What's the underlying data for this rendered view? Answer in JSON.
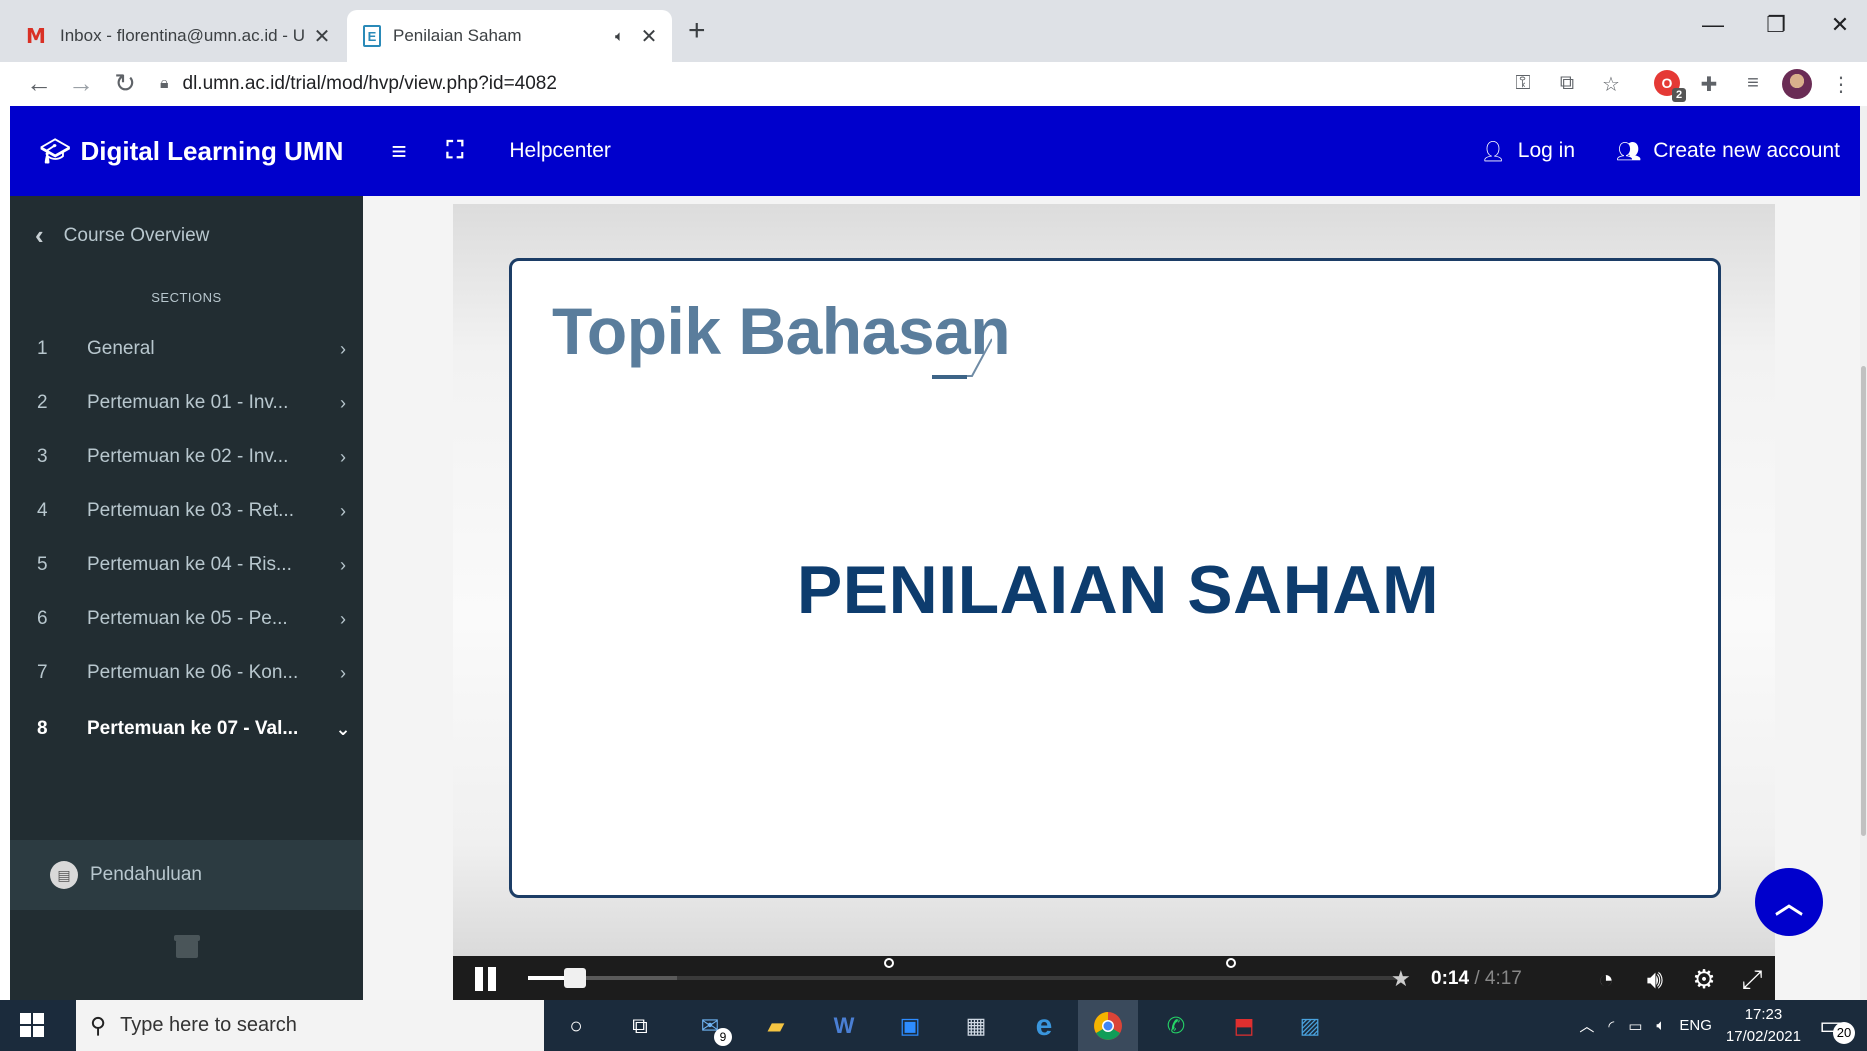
{
  "browser": {
    "tabs": [
      {
        "title": "Inbox - florentina@umn.ac.id - U",
        "favicon": "gmail-icon"
      },
      {
        "title": "Penilaian Saham",
        "favicon": "e-icon",
        "audio": true
      }
    ],
    "url": "dl.umn.ac.id/trial/mod/hvp/view.php?id=4082"
  },
  "header": {
    "brand": "Digital Learning UMN",
    "helpcenter": "Helpcenter",
    "login": "Log in",
    "create_account": "Create new account",
    "bg_color": "#0000cc"
  },
  "sidebar": {
    "back_label": "Course Overview",
    "sections_label": "SECTIONS",
    "items": [
      {
        "num": "1",
        "label": "General",
        "arrow": "›"
      },
      {
        "num": "2",
        "label": "Pertemuan ke 01 - Inv...",
        "arrow": "›"
      },
      {
        "num": "3",
        "label": "Pertemuan ke 02 - Inv...",
        "arrow": "›"
      },
      {
        "num": "4",
        "label": "Pertemuan ke 03 - Ret...",
        "arrow": "›"
      },
      {
        "num": "5",
        "label": "Pertemuan ke 04 - Ris...",
        "arrow": "›"
      },
      {
        "num": "6",
        "label": "Pertemuan ke 05 - Pe...",
        "arrow": "›"
      },
      {
        "num": "7",
        "label": "Pertemuan ke 06 - Kon...",
        "arrow": "›"
      },
      {
        "num": "8",
        "label": "Pertemuan ke 07 - Val...",
        "arrow": "⌄"
      }
    ],
    "activity": "Pendahuluan"
  },
  "video": {
    "slide_topic": "Topik Bahasan",
    "slide_title": "PENILAIAN SAHAM",
    "current_time": "0:14",
    "separator": "/",
    "duration": "4:17",
    "progress_fraction": 0.054,
    "buffered_fraction": 0.17
  },
  "taskbar": {
    "search_placeholder": "Type here to search",
    "mail_badge": "9",
    "language": "ENG",
    "time": "17:23",
    "date": "17/02/2021",
    "notification_count": "20"
  }
}
